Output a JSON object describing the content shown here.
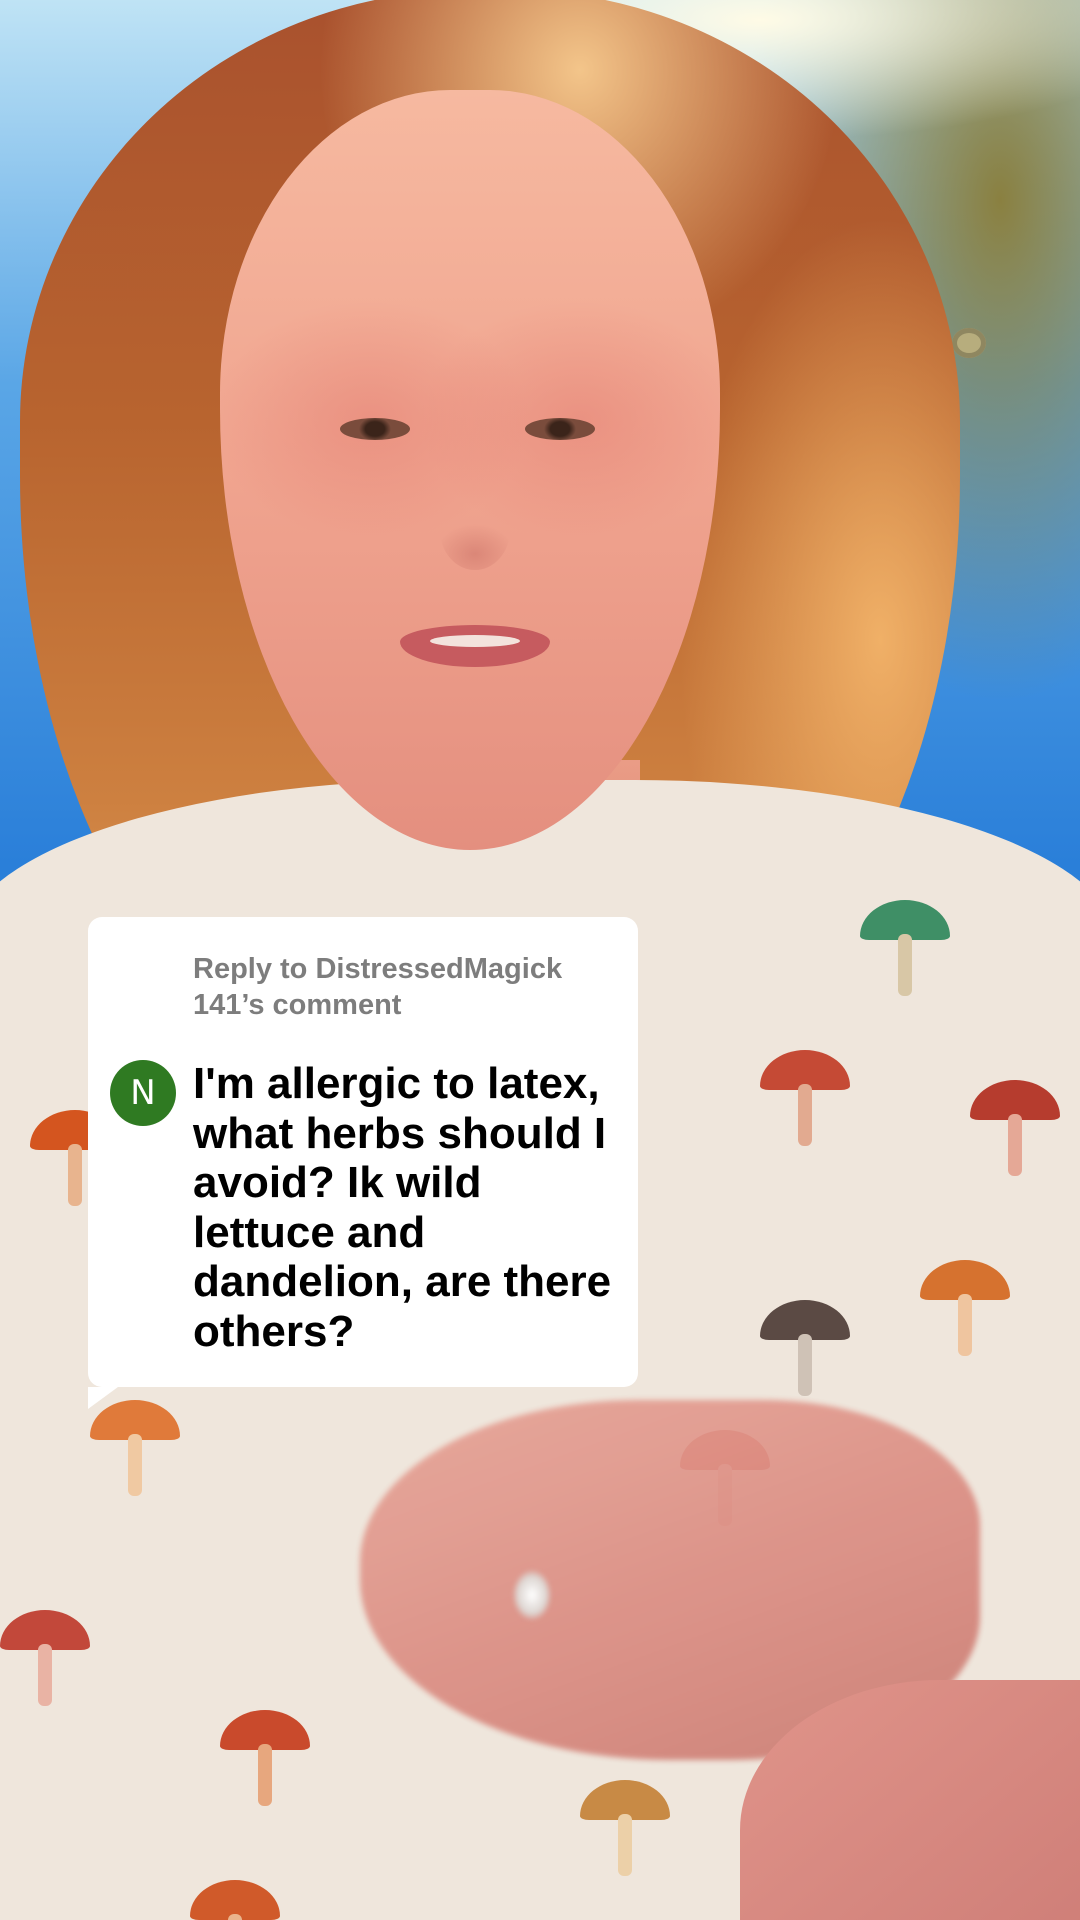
{
  "reply_card": {
    "header": "Reply to DistressedMagick 141’s comment",
    "avatar_initial": "N",
    "comment": "I'm allergic to latex, what herbs should I avoid? Ik wild lettuce and dandelion, are there others?"
  },
  "colors": {
    "avatar_bg": "#2f7a22",
    "card_bg": "#ffffff",
    "header_text": "#7d7d7d",
    "comment_text": "#000000"
  },
  "icons": {
    "avatar": "user-avatar-initial"
  }
}
